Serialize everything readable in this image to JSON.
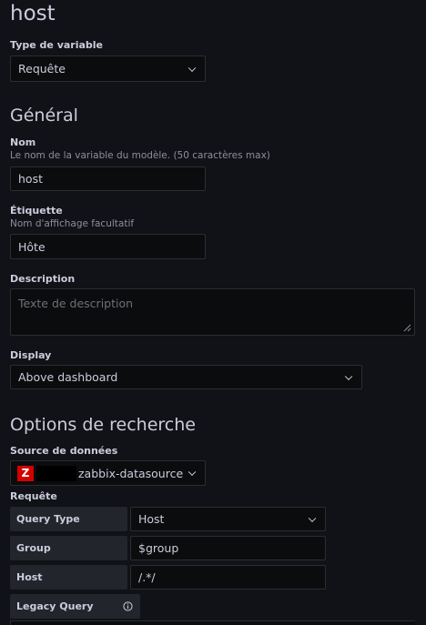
{
  "title": "host",
  "type_label": "Type de variable",
  "type_value": "Requête",
  "general_heading": "Général",
  "name_label": "Nom",
  "name_desc": "Le nom de la variable du modèle. (50 caractères max)",
  "name_value": "host",
  "label_label": "Étiquette",
  "label_desc": "Nom d'affichage facultatif",
  "label_value": "Hôte",
  "description_label": "Description",
  "description_placeholder": "Texte de description",
  "display_label": "Display",
  "display_value": "Above dashboard",
  "options_heading": "Options de recherche",
  "datasource_label": "Source de données",
  "datasource_value": "zabbix-datasource",
  "datasource_icon_letter": "Z",
  "query_label": "Requête",
  "query_rows": [
    {
      "label": "Query Type",
      "value": "Host"
    },
    {
      "label": "Group",
      "value": "$group"
    },
    {
      "label": "Host",
      "value": "/.*/"
    }
  ],
  "legacy_query_label": "Legacy Query",
  "colors": {
    "background": "#111217",
    "input": "#0b0c0e",
    "border": "#2c2d33",
    "zabbix_red": "#d40000"
  }
}
